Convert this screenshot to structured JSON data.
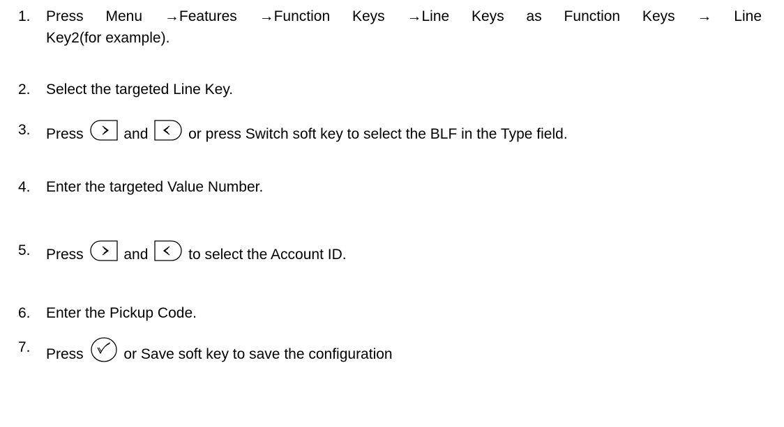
{
  "steps": [
    {
      "num": "1.",
      "line1": "Press Menu →Features →Function Keys →Line Keys as Function Keys → Line",
      "line2": "Key2(for example)."
    },
    {
      "num": "2.",
      "text": "Select the targeted Line Key."
    },
    {
      "num": "3.",
      "pre": "Press",
      "mid": "and",
      "post": "or press Switch soft key to select the BLF in the Type field."
    },
    {
      "num": "4.",
      "text": "Enter the targeted Value Number."
    },
    {
      "num": "5.",
      "pre": "Press",
      "mid": "and",
      "post": "to select the Account ID."
    },
    {
      "num": "6.",
      "text": "Enter the Pickup Code."
    },
    {
      "num": "7.",
      "pre": "Press",
      "post": "or Save soft key to save the configuration"
    }
  ],
  "icons": {
    "right": "right-arrow-key-icon",
    "left": "left-arrow-key-icon",
    "ok": "ok-checkmark-key-icon"
  }
}
